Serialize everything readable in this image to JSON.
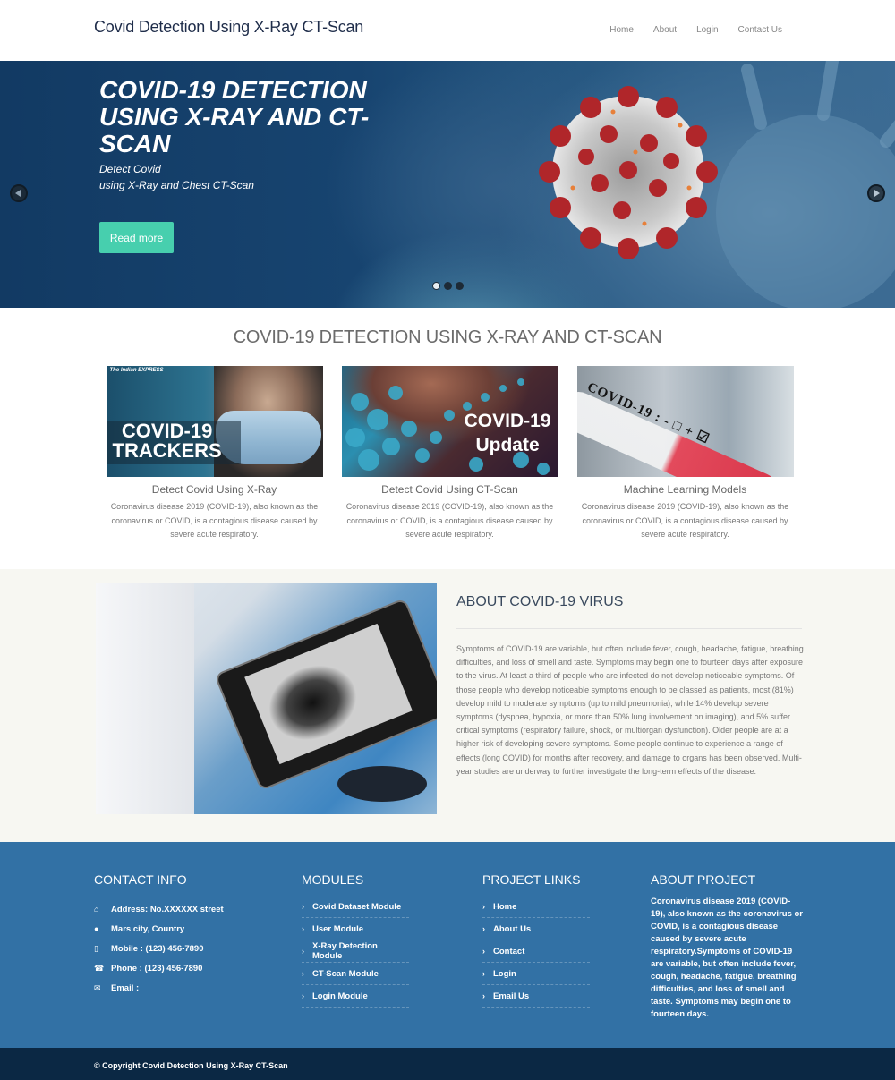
{
  "header": {
    "brand": "Covid Detection Using X-Ray CT-Scan",
    "nav": [
      "Home",
      "About",
      "Login",
      "Contact Us"
    ]
  },
  "hero": {
    "title": "COVID-19 DETECTION USING X-RAY AND CT-SCAN",
    "subtitle_line1": "Detect Covid",
    "subtitle_line2": "using X-Ray and Chest CT-Scan",
    "button": "Read more",
    "slides_total": 3,
    "active_slide": 1,
    "prev_icon": "arrow-left-circle-icon",
    "next_icon": "arrow-right-circle-icon",
    "button_color": "#47cfae"
  },
  "features": {
    "heading": "COVID-19 DETECTION USING X-RAY AND CT-SCAN",
    "cards": [
      {
        "image_text": "COVID-19 TRACKERS",
        "image_logo": "The Indian EXPRESS",
        "title": "Detect Covid Using X-Ray",
        "text": "Coronavirus disease 2019 (COVID-19), also known as the coronavirus or COVID, is a contagious disease caused by severe acute respiratory."
      },
      {
        "image_text_line1": "COVID-19",
        "image_text_line2": "Update",
        "title": "Detect Covid Using CT-Scan",
        "text": "Coronavirus disease 2019 (COVID-19), also known as the coronavirus or COVID, is a contagious disease caused by severe acute respiratory."
      },
      {
        "image_text": "COVID-19 : - □ + ☑",
        "title": "Machine Learning Models",
        "text": "Coronavirus disease 2019 (COVID-19), also known as the coronavirus or COVID, is a contagious disease caused by severe acute respiratory."
      }
    ]
  },
  "about": {
    "title": "ABOUT COVID-19 VIRUS",
    "text": "Symptoms of COVID-19 are variable, but often include fever, cough, headache, fatigue, breathing difficulties, and loss of smell and taste. Symptoms may begin one to fourteen days after exposure to the virus. At least a third of people who are infected do not develop noticeable symptoms. Of those people who develop noticeable symptoms enough to be classed as patients, most (81%) develop mild to moderate symptoms (up to mild pneumonia), while 14% develop severe symptoms (dyspnea, hypoxia, or more than 50% lung involvement on imaging), and 5% suffer critical symptoms (respiratory failure, shock, or multiorgan dysfunction). Older people are at a higher risk of developing severe symptoms. Some people continue to experience a range of effects (long COVID) for months after recovery, and damage to organs has been observed. Multi-year studies are underway to further investigate the long-term effects of the disease."
  },
  "footer": {
    "contact": {
      "heading": "CONTACT INFO",
      "items": [
        {
          "icon": "home-icon",
          "glyph": "⌂",
          "text": "Address: No.XXXXXX street"
        },
        {
          "icon": "globe-icon",
          "glyph": "●",
          "text": "Mars city, Country"
        },
        {
          "icon": "mobile-icon",
          "glyph": "▯",
          "text": "Mobile : (123) 456-7890"
        },
        {
          "icon": "phone-icon",
          "glyph": "☎",
          "text": "Phone : (123) 456-7890"
        },
        {
          "icon": "envelope-icon",
          "glyph": "✉",
          "text": "Email :"
        }
      ]
    },
    "modules": {
      "heading": "MODULES",
      "items": [
        "Covid Dataset Module",
        "User Module",
        "X-Ray Detection Module",
        "CT-Scan Module",
        "Login Module"
      ]
    },
    "links": {
      "heading": "PROJECT LINKS",
      "items": [
        "Home",
        "About Us",
        "Contact",
        "Login",
        "Email Us"
      ]
    },
    "about_project": {
      "heading": "ABOUT PROJECT",
      "text": "Coronavirus disease 2019 (COVID-19), also known as the coronavirus or COVID, is a contagious disease caused by severe acute respiratory.Symptoms of COVID-19 are variable, but often include fever, cough, headache, fatigue, breathing difficulties, and loss of smell and taste. Symptoms may begin one to fourteen days."
    },
    "copyright": "© Copyright Covid Detection Using X-Ray CT-Scan",
    "colors": {
      "footer_bg": "#3271a5",
      "copyright_bg": "#0b2844"
    }
  }
}
